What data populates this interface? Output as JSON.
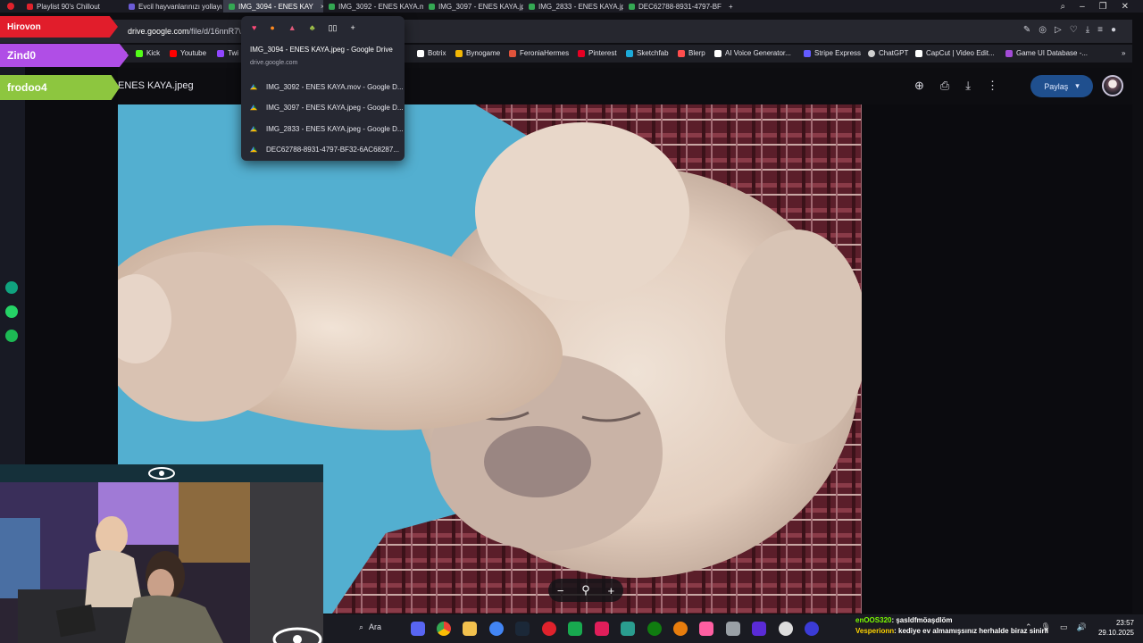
{
  "tabs": [
    {
      "label": "Playlist 90's Chillout",
      "color": "#e0222c"
    },
    {
      "label": "Evcil hayvanlarınızı yollayı",
      "color": "#6b5bd6"
    },
    {
      "label": "IMG_3094 - ENES KAY",
      "color": "#34a853"
    },
    {
      "label": "IMG_3092 - ENES KAYA.m",
      "color": "#34a853"
    },
    {
      "label": "IMG_3097 - ENES KAYA.jp",
      "color": "#34a853"
    },
    {
      "label": "IMG_2833 - ENES KAYA.jp",
      "color": "#34a853"
    },
    {
      "label": "DEC62788-8931-4797-BF",
      "color": "#34a853"
    }
  ],
  "active_tab_close": "×",
  "new_tab": "+",
  "address": {
    "url_host": "drive.google.com",
    "url_path": "/file/d/16nnR7\\"
  },
  "bookmarks": [
    {
      "label": "ive",
      "color": "#7a4bd6"
    },
    {
      "label": "Kick",
      "color": "#53fc18"
    },
    {
      "label": "Youtube",
      "color": "#ff0000"
    },
    {
      "label": "Twi",
      "color": "#9146ff"
    },
    {
      "label": "Botrix",
      "color": "#ffffff"
    },
    {
      "label": "Bynogame",
      "color": "#f2b705"
    },
    {
      "label": "FeroniaHermes",
      "color": "#e0533b"
    },
    {
      "label": "Pinterest",
      "color": "#e60023"
    },
    {
      "label": "Sketchfab",
      "color": "#1caad9"
    },
    {
      "label": "Blerp",
      "color": "#ff4d4d"
    },
    {
      "label": "AI Voice Generator...",
      "color": "#ffffff"
    },
    {
      "label": "Stripe Express",
      "color": "#635bff"
    },
    {
      "label": "ChatGPT",
      "color": "#cfcfcf"
    },
    {
      "label": "CapCut | Video Edit...",
      "color": "#ffffff"
    },
    {
      "label": "Game UI Database -...",
      "color": "#a24bd6"
    }
  ],
  "dropdown": {
    "title": "IMG_3094 - ENES KAYA.jpeg - Google Drive",
    "subtitle": "drive.google.com",
    "items": [
      "IMG_3092 - ENES KAYA.mov - Google D...",
      "IMG_3097 - ENES KAYA.jpeg - Google D...",
      "IMG_2833 - ENES KAYA.jpeg - Google D...",
      "DEC62788-8931-4797-BF32-6AC68287..."
    ]
  },
  "drive": {
    "file_title": "ENES KAYA.jpeg",
    "share_label": "Paylaş"
  },
  "overlay_badges": [
    {
      "label": "Hirovon",
      "color": "#e11d2b"
    },
    {
      "label": "Zind0",
      "color": "#b04ee6"
    },
    {
      "label": "frodoo4",
      "color": "#8dc63f"
    }
  ],
  "taskbar": {
    "search_label": "Ara"
  },
  "chat": [
    {
      "user": "enOOS320",
      "message": ": şasldfmöaşdlöm",
      "user_color": "#7cfc00"
    },
    {
      "user": "Vesperionn",
      "message": ": kediye ev almamışsınız herhalde biraz sinirli",
      "user_color": "#ffd400"
    }
  ],
  "clock": {
    "time": "23:57",
    "date": "29.10.2025"
  }
}
